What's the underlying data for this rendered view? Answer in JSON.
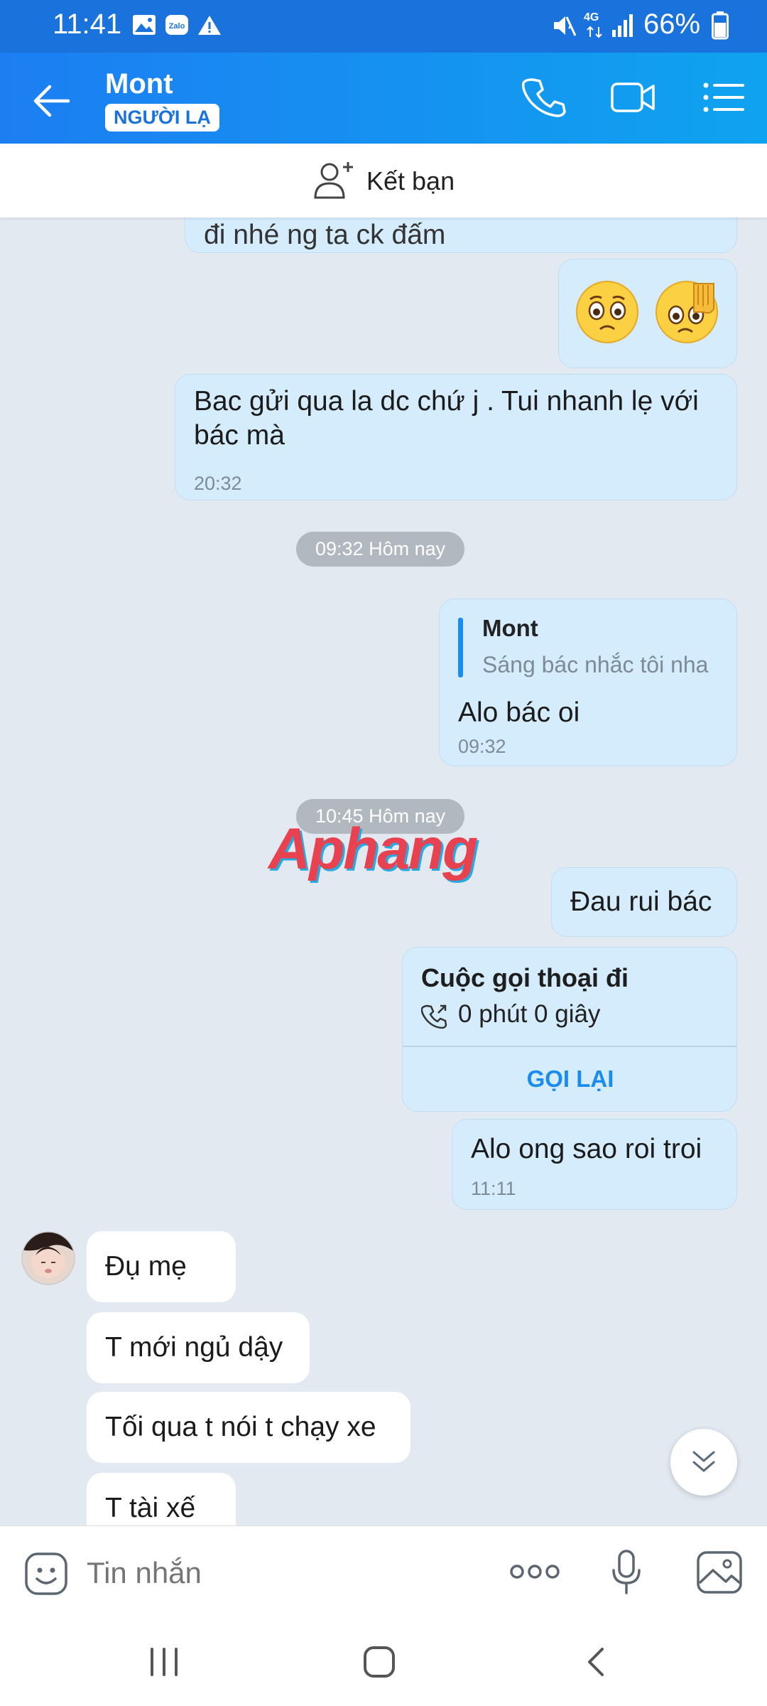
{
  "status": {
    "time": "11:41",
    "network": "4G",
    "battery": "66%"
  },
  "header": {
    "name": "Mont",
    "badge": "NGƯỜI LẠ"
  },
  "add_friend": {
    "label": "Kết bạn"
  },
  "messages": {
    "m0_partial": "đi nhé ng ta ck đấm",
    "m2_text": "Bac gửi qua la dc chứ j . Tui nhanh lẹ với bác mà",
    "m2_time": "20:32",
    "sep1": "09:32 Hôm nay",
    "reply_name": "Mont",
    "reply_quote": "Sáng bác nhắc tôi nha",
    "m3_text": "Alo bác oi",
    "m3_time": "09:32",
    "sep2": "10:45 Hôm nay",
    "m4_text": "Đau rui bác",
    "call_title": "Cuộc gọi thoại đi",
    "call_duration": "0 phút 0 giây",
    "call_again": "GỌI LẠI",
    "m5_text": "Alo ong sao roi troi",
    "m5_time": "11:11",
    "r1": "Đụ mẹ",
    "r2": "T mới ngủ dậy",
    "r3": "Tối qua t nói t chạy xe",
    "r4": "T tài xế"
  },
  "watermark": "Aphang",
  "input": {
    "placeholder": "Tin nhắn"
  },
  "colors": {
    "header": "#1c7ef2",
    "outgoing_bubble": "#d5ecfd",
    "incoming_bubble": "#ffffff",
    "accent": "#1a73dd"
  }
}
